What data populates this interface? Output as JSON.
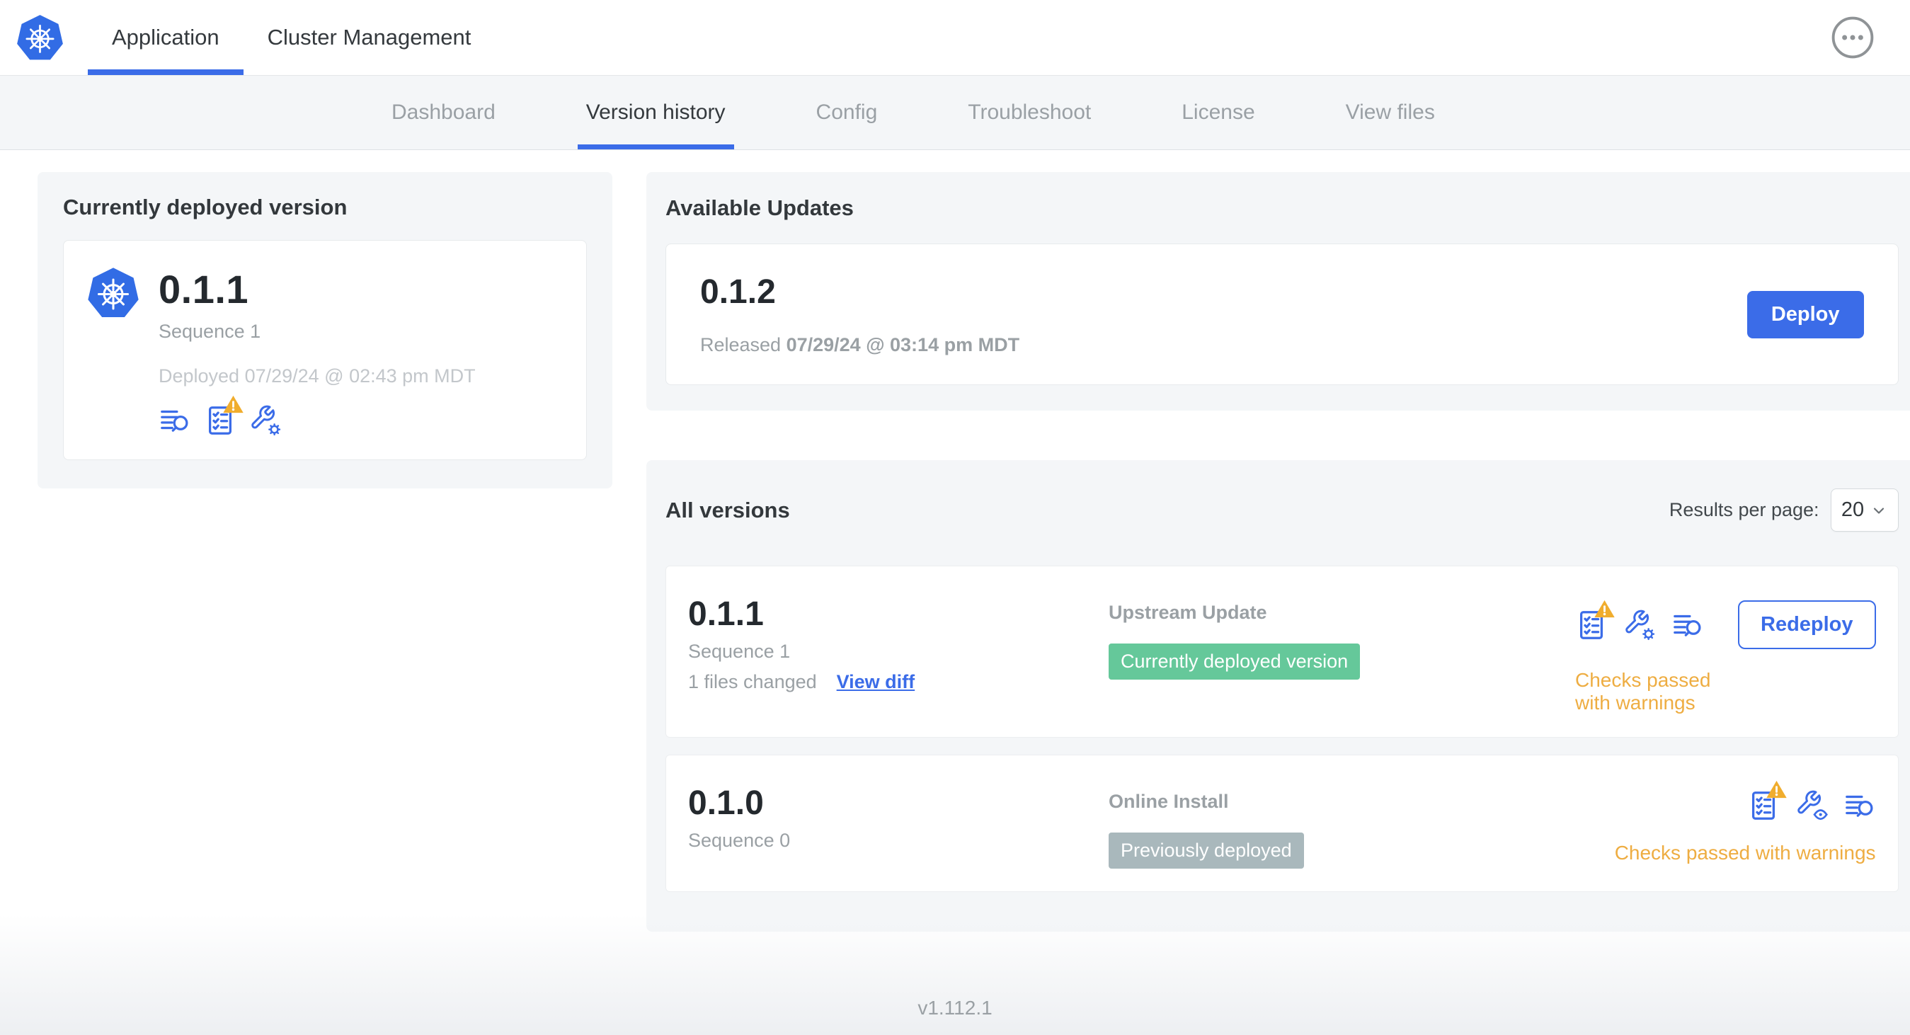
{
  "colors": {
    "accent_blue": "#3b6ce8",
    "kubernetes_blue": "#326ce5",
    "success_green": "#65c89a",
    "muted_badge_gray": "#a9b8bc",
    "warning_orange": "#eead42",
    "card_gray": "#f4f6f8"
  },
  "icons": {
    "app_logo": "kubernetes-logo",
    "overflow_menu": "ellipsis-icon",
    "logs": "logs-icon",
    "preflight_checks": "preflight-checklist-icon",
    "preflight_warning": "warning-triangle-icon",
    "edit_config": "wrench-gear-icon",
    "view_config": "wrench-eye-icon",
    "results_dropdown": "chevron-down-icon"
  },
  "header": {
    "tabs": [
      {
        "label": "Application",
        "active": true
      },
      {
        "label": "Cluster Management",
        "active": false
      }
    ]
  },
  "subnav": {
    "tabs": [
      {
        "label": "Dashboard",
        "active": false
      },
      {
        "label": "Version history",
        "active": true
      },
      {
        "label": "Config",
        "active": false
      },
      {
        "label": "Troubleshoot",
        "active": false
      },
      {
        "label": "License",
        "active": false
      },
      {
        "label": "View files",
        "active": false
      }
    ]
  },
  "current_version": {
    "title": "Currently deployed version",
    "version": "0.1.1",
    "sequence": "Sequence 1",
    "deployed": "Deployed 07/29/24 @ 02:43 pm MDT"
  },
  "available_updates": {
    "title": "Available Updates",
    "version": "0.1.2",
    "released_label": "Released",
    "released_date": "07/29/24 @ 03:14 pm MDT",
    "deploy_button": "Deploy"
  },
  "all_versions": {
    "title": "All versions",
    "results_per_page_label": "Results per page:",
    "results_per_page_value": "20",
    "rows": [
      {
        "version": "0.1.1",
        "sequence": "Sequence 1",
        "files_changed": "1 files changed",
        "view_diff_link": "View diff",
        "source": "Upstream Update",
        "badge": "Currently deployed version",
        "status": "Checks passed with warnings",
        "action_button": "Redeploy"
      },
      {
        "version": "0.1.0",
        "sequence": "Sequence 0",
        "source": "Online Install",
        "badge": "Previously deployed",
        "status": "Checks passed with warnings"
      }
    ]
  },
  "footer": {
    "app_version": "v1.112.1"
  }
}
